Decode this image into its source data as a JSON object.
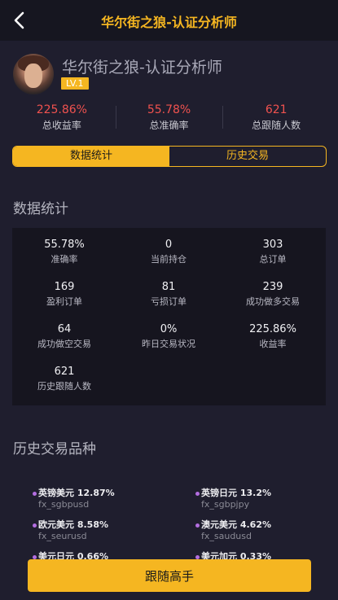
{
  "header": {
    "title": "华尔街之狼-认证分析师",
    "back_icon": "chevron-left-icon"
  },
  "profile": {
    "name": "华尔街之狼-认证分析师",
    "level": "LV.1"
  },
  "summary": [
    {
      "value": "225.86%",
      "label": "总收益率"
    },
    {
      "value": "55.78%",
      "label": "总准确率"
    },
    {
      "value": "621",
      "label": "总跟随人数"
    }
  ],
  "tabs": [
    {
      "label": "数据统计",
      "active": true
    },
    {
      "label": "历史交易",
      "active": false
    }
  ],
  "stats_section": {
    "title": "数据统计",
    "items": [
      {
        "value": "55.78%",
        "label": "准确率"
      },
      {
        "value": "0",
        "label": "当前持仓"
      },
      {
        "value": "303",
        "label": "总订单"
      },
      {
        "value": "169",
        "label": "盈利订单"
      },
      {
        "value": "81",
        "label": "亏损订单"
      },
      {
        "value": "239",
        "label": "成功做多交易"
      },
      {
        "value": "64",
        "label": "成功做空交易"
      },
      {
        "value": "0%",
        "label": "昨日交易状况"
      },
      {
        "value": "225.86%",
        "label": "收益率"
      },
      {
        "value": "621",
        "label": "历史跟随人数"
      }
    ]
  },
  "history_section": {
    "title": "历史交易品种",
    "items": [
      {
        "name": "英镑美元 12.87%",
        "code": "fx_sgbpusd"
      },
      {
        "name": "英镑日元 13.2%",
        "code": "fx_sgbpjpy"
      },
      {
        "name": "欧元美元 8.58%",
        "code": "fx_seurusd"
      },
      {
        "name": "澳元美元 4.62%",
        "code": "fx_saudusd"
      },
      {
        "name": "美元日元 0.66%",
        "code": ""
      },
      {
        "name": "美元加元 0.33%",
        "code": ""
      }
    ]
  },
  "follow_button": {
    "label": "跟随高手"
  },
  "colors": {
    "accent": "#f5b621",
    "value_red": "#f0524f",
    "background": "#1f1e2e",
    "legend_dot": "#b36ee0"
  }
}
